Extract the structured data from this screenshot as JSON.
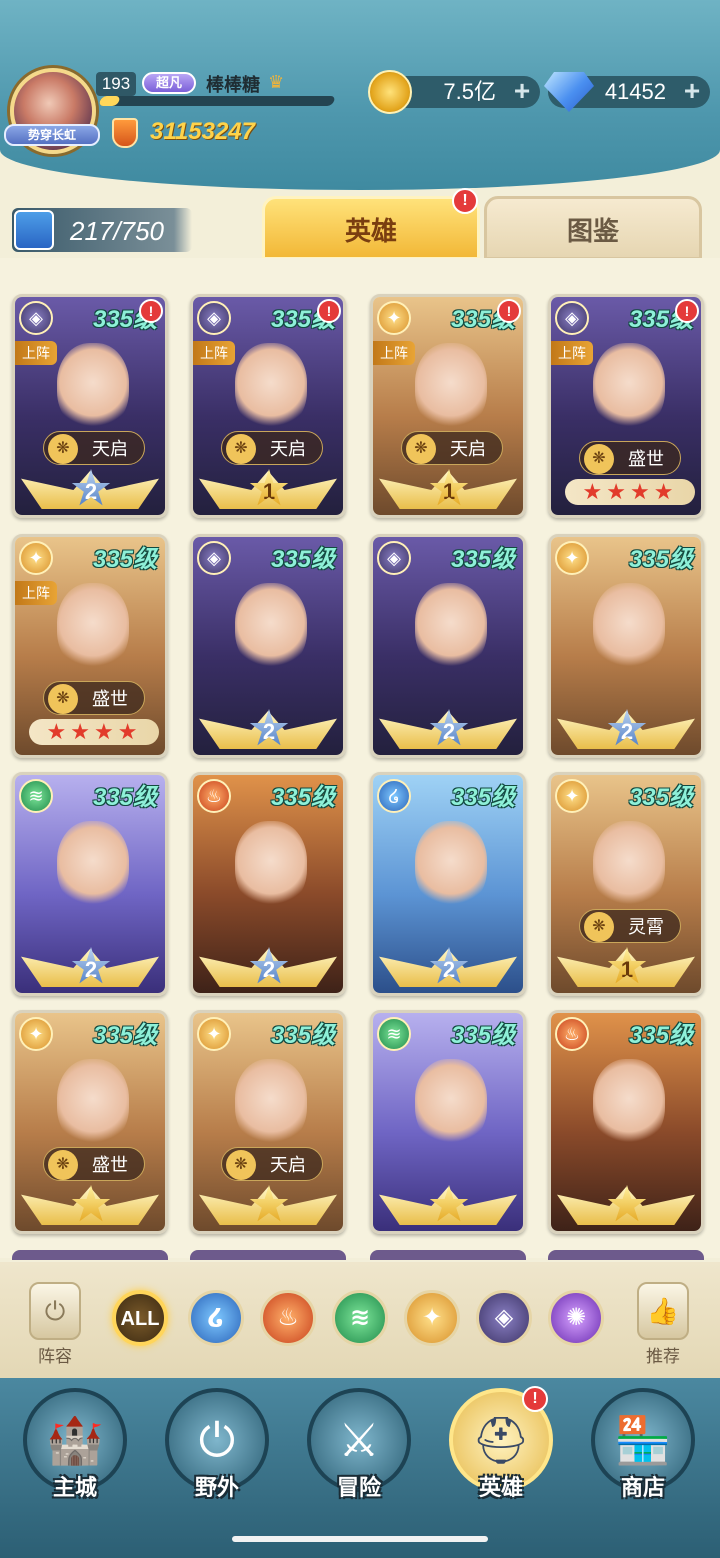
{
  "player": {
    "title_ribbon": "势穿长虹",
    "level": "193",
    "vip": "超凡",
    "name": "棒棒糖",
    "power": "31153247",
    "exp_fraction": 0.08
  },
  "currency": {
    "gold": "7.5亿",
    "gems": "41452",
    "plus": "+"
  },
  "collection": {
    "count": "217/750"
  },
  "tabs": {
    "heroes": "英雄",
    "codex": "图鉴",
    "alert": "!"
  },
  "deploy_label": "上阵",
  "heroes": [
    {
      "level": "335级",
      "element": "shadow",
      "deployed": true,
      "rank": "天启",
      "star": "2",
      "star_type": "silver",
      "alert": true
    },
    {
      "level": "335级",
      "element": "shadow",
      "deployed": true,
      "rank": "天启",
      "star": "1",
      "star_type": "gold",
      "alert": true
    },
    {
      "level": "335级",
      "element": "light",
      "deployed": true,
      "rank": "天启",
      "star": "1",
      "star_type": "gold",
      "alert": true
    },
    {
      "level": "335级",
      "element": "shadow",
      "deployed": true,
      "rank": "盛世",
      "red_stars": "★★★★",
      "alert": true
    },
    {
      "level": "335级",
      "element": "light",
      "deployed": true,
      "rank": "盛世",
      "red_stars": "★★★★"
    },
    {
      "level": "335级",
      "element": "shadow",
      "star": "2",
      "star_type": "silver"
    },
    {
      "level": "335级",
      "element": "shadow",
      "star": "2",
      "star_type": "silver"
    },
    {
      "level": "335级",
      "element": "light",
      "star": "2",
      "star_type": "silver"
    },
    {
      "level": "335级",
      "element": "wind",
      "star": "2",
      "star_type": "silver"
    },
    {
      "level": "335级",
      "element": "fire",
      "star": "2",
      "star_type": "silver"
    },
    {
      "level": "335级",
      "element": "water",
      "star": "2",
      "star_type": "silver"
    },
    {
      "level": "335级",
      "element": "light",
      "rank": "灵霄",
      "star": "1",
      "star_type": "gold"
    },
    {
      "level": "335级",
      "element": "light",
      "rank": "盛世",
      "star": "",
      "star_type": "gold"
    },
    {
      "level": "335级",
      "element": "light",
      "rank": "天启",
      "star": "",
      "star_type": "gold"
    },
    {
      "level": "335级",
      "element": "wind",
      "star": "",
      "star_type": "gold"
    },
    {
      "level": "335级",
      "element": "fire",
      "star": "",
      "star_type": "gold"
    }
  ],
  "filters": {
    "left_label": "阵容",
    "right_label": "推荐",
    "items": [
      {
        "name": "all",
        "label": "ALL"
      },
      {
        "name": "water",
        "label": ""
      },
      {
        "name": "fire",
        "label": ""
      },
      {
        "name": "wind",
        "label": ""
      },
      {
        "name": "light",
        "label": ""
      },
      {
        "name": "shadow",
        "label": ""
      },
      {
        "name": "void",
        "label": ""
      }
    ]
  },
  "nav": [
    {
      "name": "main-city",
      "label": "主城",
      "icon": "castle-icon"
    },
    {
      "name": "wild",
      "label": "野外",
      "icon": "portal-icon"
    },
    {
      "name": "adventure",
      "label": "冒险",
      "icon": "sword-icon"
    },
    {
      "name": "heroes",
      "label": "英雄",
      "icon": "helmet-icon",
      "active": true,
      "alert": true
    },
    {
      "name": "shop",
      "label": "商店",
      "icon": "shop-icon"
    }
  ],
  "colors": {
    "header": "#4e97ad",
    "level_text": "#8ef0d8",
    "alert": "#e43a3a",
    "active_tab": "#f2b837"
  }
}
